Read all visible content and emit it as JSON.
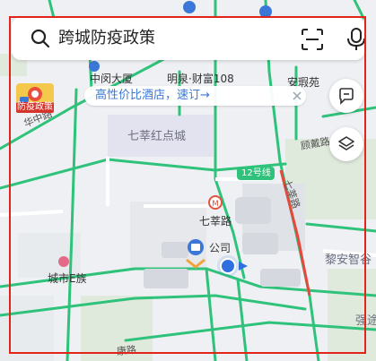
{
  "search": {
    "query": "跨城防疫政策"
  },
  "promo": {
    "text": "高性价比酒店，速订→"
  },
  "fangyi_badge": {
    "label": "防疫政策"
  },
  "map_labels": {
    "zhongmin": "中闵大厦",
    "mingquan": "明泉·财富108",
    "anzhiyuan": "安瑕苑",
    "huazhong": "华中路",
    "qixin_red": "七莘红点城",
    "gudai": "顾戴路",
    "line12": "12号线",
    "qixin_road": "七莘路",
    "qixin_station": "七莘路",
    "gongsi": "公司",
    "chengshi": "城市E族",
    "lijia": "黎安智谷",
    "qiang": "强途",
    "kang": "康路"
  },
  "colors": {
    "accent": "#3a77d6",
    "road_green": "#2fc27a",
    "frame_red": "#e3241b"
  }
}
